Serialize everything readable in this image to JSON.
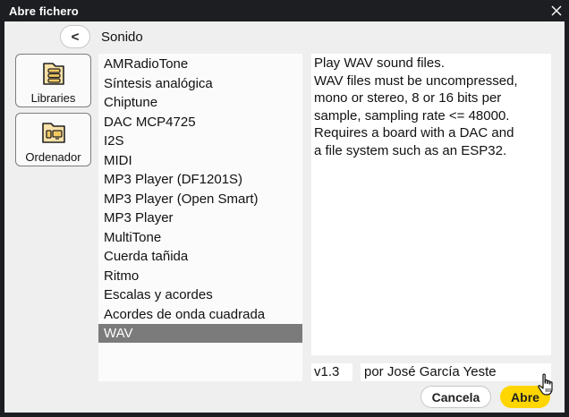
{
  "window": {
    "title": "Abre fichero"
  },
  "nav": {
    "back_label": "<",
    "path": "Sonido"
  },
  "sidebar": [
    {
      "label": "Libraries",
      "icon": "library-books-icon"
    },
    {
      "label": "Ordenador",
      "icon": "computer-folder-icon"
    }
  ],
  "files": [
    "AMRadioTone",
    "Síntesis analógica",
    "Chiptune",
    "DAC MCP4725",
    "I2S",
    "MIDI",
    "MP3 Player (DF1201S)",
    "MP3 Player (Open Smart)",
    "MP3 Player",
    "MultiTone",
    "Cuerda tañida",
    "Ritmo",
    "Escalas y acordes",
    "Acordes de onda cuadrada",
    "WAV"
  ],
  "selected_file": "WAV",
  "description": [
    "Play WAV sound files.",
    "WAV files must be uncompressed,",
    "mono or stereo, 8 or 16 bits per",
    "sample, sampling rate <= 48000.",
    "Requires a board with a DAC and",
    "a file system such as an ESP32."
  ],
  "info": {
    "version": "v1.3",
    "author": "por José García Yeste"
  },
  "buttons": {
    "cancel": "Cancela",
    "open": "Abre"
  },
  "colors": {
    "titlebar": "#1c1e22",
    "selection": "#7b7b7b",
    "accent": "#ffd600"
  }
}
